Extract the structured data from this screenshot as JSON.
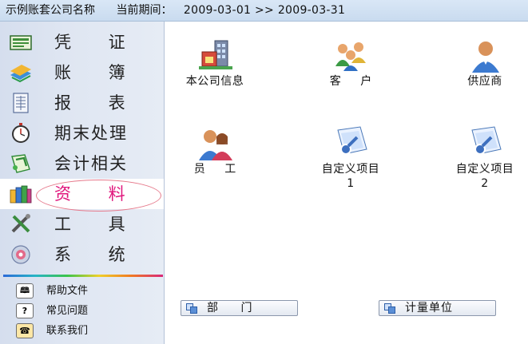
{
  "title": {
    "company": "示例账套公司名称",
    "period_label": "当前期间：",
    "period_range": "2009-03-01 >> 2009-03-31"
  },
  "sidebar": {
    "items": [
      {
        "label": "凭  证",
        "icon": "voucher-icon"
      },
      {
        "label": "账  簿",
        "icon": "ledger-books-icon"
      },
      {
        "label": "报  表",
        "icon": "report-sheet-icon"
      },
      {
        "label": "期末处理",
        "icon": "stopwatch-icon"
      },
      {
        "label": "会计相关",
        "icon": "accounting-icon"
      },
      {
        "label": "资  料",
        "icon": "data-books-icon",
        "active": true
      },
      {
        "label": "工  具",
        "icon": "tools-icon"
      },
      {
        "label": "系  统",
        "icon": "system-icon"
      }
    ],
    "help": [
      {
        "label": "帮助文件",
        "icon": "help-book-icon"
      },
      {
        "label": "常见问题",
        "icon": "question-icon"
      },
      {
        "label": "联系我们",
        "icon": "telephone-icon"
      }
    ]
  },
  "main": {
    "tiles": [
      {
        "label": "本公司信息",
        "icon": "company-info-icon"
      },
      {
        "label": "客 户",
        "icon": "customers-icon"
      },
      {
        "label": "供应商",
        "icon": "supplier-icon"
      },
      {
        "label": "员 工",
        "icon": "employees-icon"
      },
      {
        "label": "自定义项目",
        "label2": "1",
        "icon": "custom-item-icon"
      },
      {
        "label": "自定义项目",
        "label2": "2",
        "icon": "custom-item-icon"
      }
    ],
    "buttons": [
      {
        "label": "部  门",
        "icon": "department-icon"
      },
      {
        "label": "计量单位",
        "icon": "measurement-unit-icon"
      }
    ]
  },
  "colors": {
    "active_label": "#e0167c",
    "highlight_ellipse": "#e67a8c",
    "sidebar_bg": "#dfe6f2"
  }
}
